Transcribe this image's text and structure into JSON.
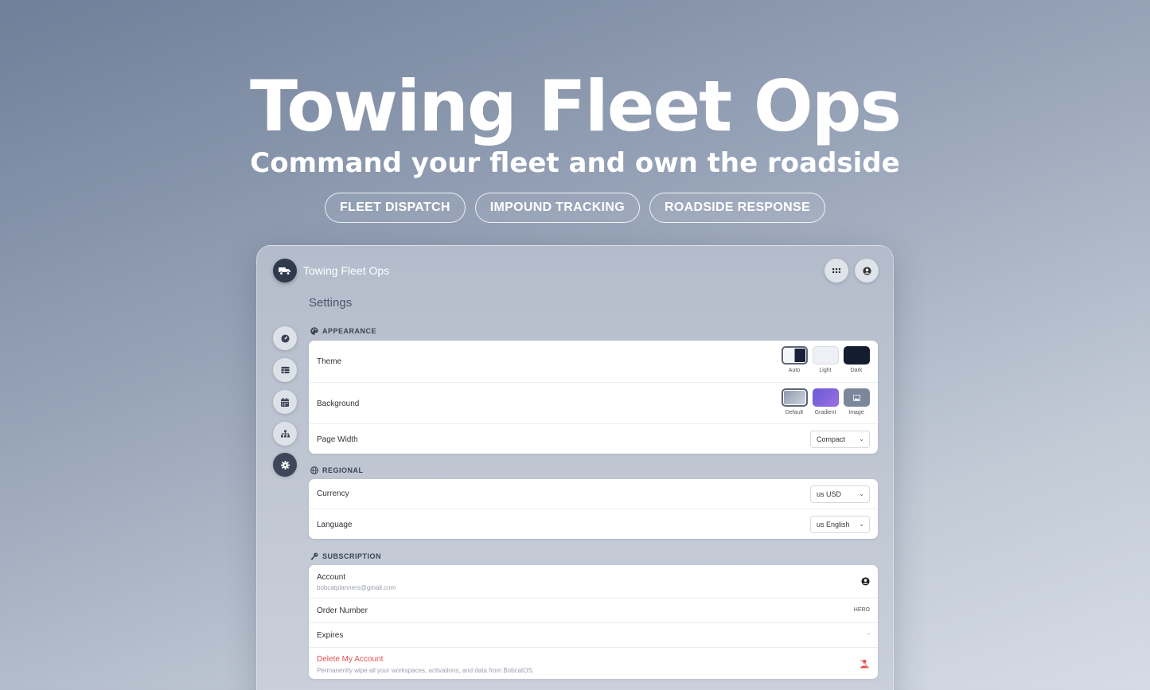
{
  "hero": {
    "title": "Towing Fleet Ops",
    "subtitle": "Command your fleet and own the roadside",
    "pills": [
      "FLEET DISPATCH",
      "IMPOUND TRACKING",
      "ROADSIDE RESPONSE"
    ]
  },
  "app": {
    "title": "Towing Fleet Ops",
    "logo_icon": "tow-truck-icon",
    "header_buttons": [
      "apps-grid-icon",
      "user-circle-icon"
    ]
  },
  "sidebar": {
    "items": [
      {
        "icon": "dashboard-gauge-icon",
        "active": false
      },
      {
        "icon": "table-icon",
        "active": false
      },
      {
        "icon": "calendar-icon",
        "active": false
      },
      {
        "icon": "org-chart-icon",
        "active": false
      },
      {
        "icon": "gear-icon",
        "active": true
      }
    ]
  },
  "settings": {
    "page_title": "Settings",
    "appearance": {
      "label": "APPEARANCE",
      "theme_label": "Theme",
      "theme_options": [
        "Auto",
        "Light",
        "Dark"
      ],
      "theme_selected": "Auto",
      "background_label": "Background",
      "background_options": [
        "Default",
        "Gradient",
        "Image"
      ],
      "background_selected": "Default",
      "page_width_label": "Page Width",
      "page_width_value": "Compact"
    },
    "regional": {
      "label": "REGIONAL",
      "currency_label": "Currency",
      "currency_value": "us USD",
      "language_label": "Language",
      "language_value": "us English"
    },
    "subscription": {
      "label": "SUBSCRIPTION",
      "account_label": "Account",
      "account_email": "bobcatplanners@gmail.com",
      "order_label": "Order Number",
      "order_value": "HERO",
      "expires_label": "Expires",
      "expires_value": "-",
      "delete_label": "Delete My Account",
      "delete_desc": "Permanently wipe all your workspaces, activations, and data from BobcatOS."
    }
  },
  "colors": {
    "accent_dark": "#3d4759",
    "danger": "#e05050",
    "gradient_swatch": "#7b62d8"
  }
}
